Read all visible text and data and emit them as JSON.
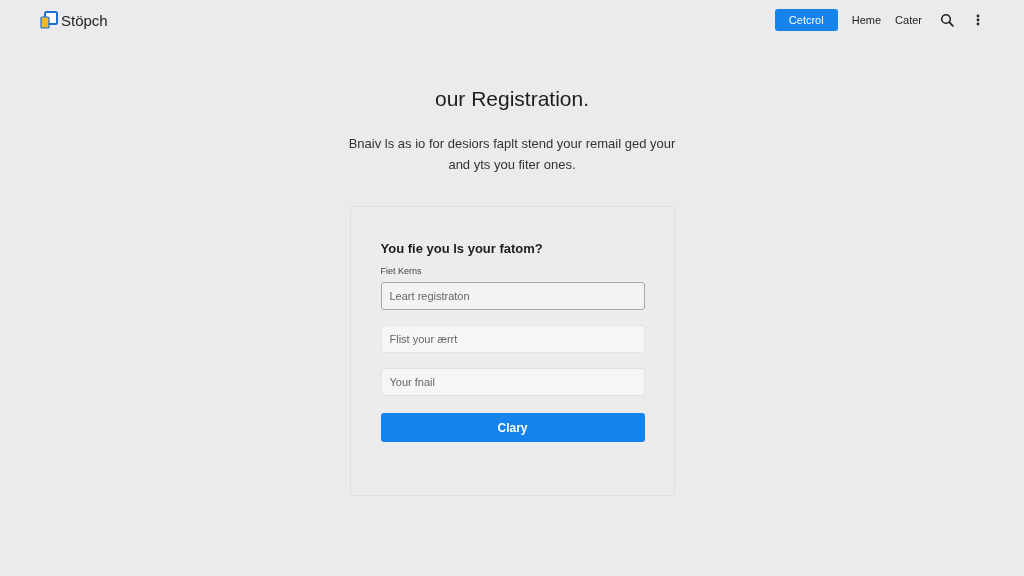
{
  "header": {
    "logo_text": "Stöpch",
    "nav": [
      {
        "label": "Cetcrol",
        "kind": "primary"
      },
      {
        "label": "Heme",
        "kind": "link"
      },
      {
        "label": "Cater",
        "kind": "link"
      }
    ]
  },
  "title": "our Registration.",
  "intro": "Bnaiv ls as io for desiors faplt stend your remail ged your and yts you fiter ones.",
  "form": {
    "heading": "You fie you ls your fatom?",
    "label": "Fiet Kerns",
    "fields": [
      {
        "placeholder": "Leart registraton",
        "focused": true
      },
      {
        "placeholder": "Flist your ærrt",
        "focused": false
      },
      {
        "placeholder": "Your fnail",
        "focused": false
      }
    ],
    "submit": "Clary"
  }
}
